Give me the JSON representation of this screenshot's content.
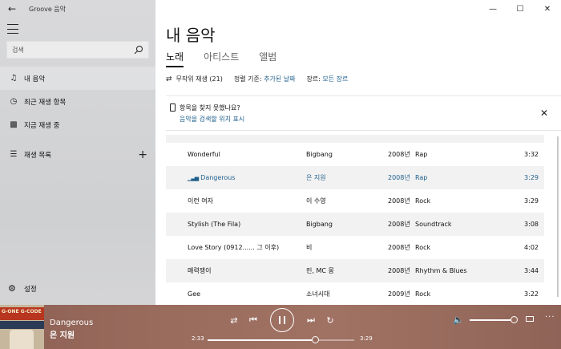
{
  "app": {
    "title": "Groove 음악"
  },
  "sidebar": {
    "search_placeholder": "검색",
    "items": [
      {
        "label": "내 음악",
        "icon": "music-note-icon"
      },
      {
        "label": "최근 재생 항목",
        "icon": "clock-icon"
      },
      {
        "label": "지금 재생 중",
        "icon": "equalizer-icon"
      },
      {
        "label": "재생 목록",
        "icon": "playlist-icon"
      }
    ],
    "settings_label": "설정"
  },
  "main": {
    "title": "내 음악",
    "tabs": [
      "노래",
      "아티스트",
      "앨범"
    ],
    "active_tab": "노래",
    "toolbar": {
      "shuffle_label": "무작위 재생 (21)",
      "sort_prefix": "정렬 기준:",
      "sort_value": "추가된 날짜",
      "genre_prefix": "장르:",
      "genre_value": "모든 장르"
    },
    "notice": {
      "question": "항목을 찾지 못했나요?",
      "link": "음악을 검색할 위치 표시"
    },
    "songs": [
      {
        "title": "Wonderful",
        "artist": "Bigbang",
        "year": "2008년",
        "genre": "Rap",
        "duration": "3:32"
      },
      {
        "title": "Dangerous",
        "artist": "은 지원",
        "year": "2008년",
        "genre": "Rap",
        "duration": "3:29",
        "playing": true
      },
      {
        "title": "이런 여자",
        "artist": "이 수영",
        "year": "2008년",
        "genre": "Rock",
        "duration": "3:29"
      },
      {
        "title": "Stylish (The Fila)",
        "artist": "Bigbang",
        "year": "2008년",
        "genre": "Soundtrack",
        "duration": "3:08"
      },
      {
        "title": "Love Story (0912...... 그 이후)",
        "artist": "비",
        "year": "2008년",
        "genre": "Rock",
        "duration": "4:02"
      },
      {
        "title": "매력쟁이",
        "artist": "린, MC 몽",
        "year": "2008년",
        "genre": "Rhythm & Blues",
        "duration": "3:44"
      },
      {
        "title": "Gee",
        "artist": "소녀시대",
        "year": "2009년",
        "genre": "Rock",
        "duration": "3:22"
      }
    ]
  },
  "player": {
    "album_art_text": "G-ONE G-CODE",
    "track_title": "Dangerous",
    "track_artist": "은 지원",
    "current_time": "2:33",
    "total_time": "3:29",
    "progress": 0.73,
    "volume": 1.0
  },
  "colors": {
    "accent": "#1e5f8c",
    "player_bg": "#9a6c5e"
  }
}
